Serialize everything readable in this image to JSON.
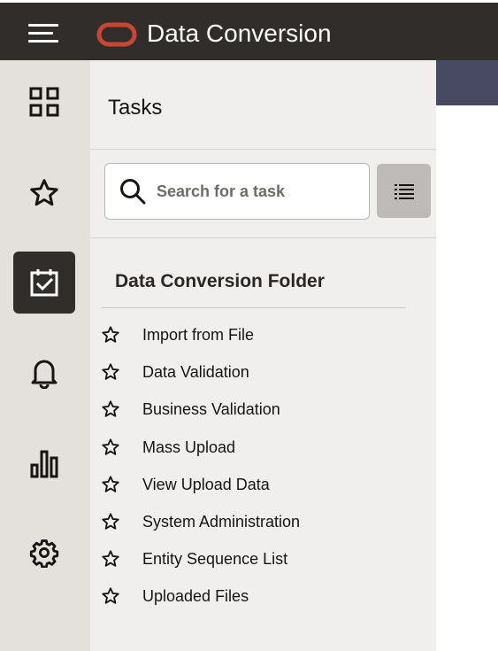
{
  "header": {
    "title": "Data Conversion",
    "menu_icon": "hamburger-menu-icon",
    "logo_icon": "oracle-logo-icon",
    "background_color": "#312d2a"
  },
  "rail": {
    "items": [
      {
        "icon": "grid-icon",
        "active": false
      },
      {
        "icon": "star-icon",
        "active": false
      },
      {
        "icon": "calendar-check-icon",
        "active": true
      },
      {
        "icon": "bell-icon",
        "active": false
      },
      {
        "icon": "bar-chart-icon",
        "active": false
      },
      {
        "icon": "gear-icon",
        "active": false
      }
    ]
  },
  "tasks_panel": {
    "title": "Tasks",
    "search": {
      "placeholder": "Search for a task",
      "value": ""
    },
    "list_button_icon": "list-icon",
    "folder": {
      "title": "Data Conversion Folder",
      "items": [
        {
          "label": "Import from File"
        },
        {
          "label": "Data Validation"
        },
        {
          "label": "Business Validation"
        },
        {
          "label": "Mass Upload"
        },
        {
          "label": "View Upload Data"
        },
        {
          "label": "System Administration"
        },
        {
          "label": "Entity Sequence List"
        },
        {
          "label": "Uploaded Files"
        }
      ]
    }
  },
  "colors": {
    "accent_logo": "#c74634",
    "rail_background": "#e4e1dd",
    "panel_background": "#f1efed",
    "banner": "#484a63"
  }
}
